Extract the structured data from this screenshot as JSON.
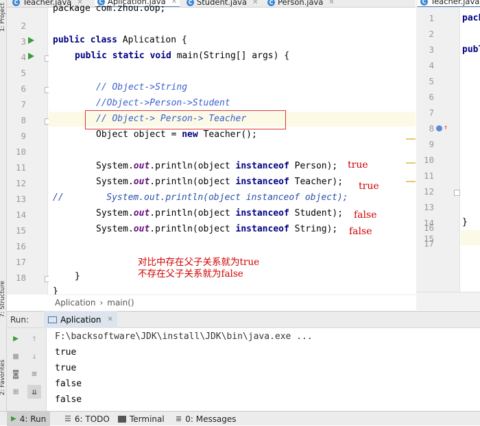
{
  "tabs": [
    {
      "label": "Teacher.java",
      "active": false
    },
    {
      "label": "Aplication.java",
      "active": true
    },
    {
      "label": "Student.java",
      "active": false
    },
    {
      "label": "Person.java",
      "active": false
    }
  ],
  "right_tab": {
    "label": "Teacher.java"
  },
  "left_strip": {
    "project": "1: Project",
    "structure": "7: Structure",
    "favorites": "2: Favorites"
  },
  "editor": {
    "line_numbers": [
      "2",
      "3",
      "4",
      "5",
      "6",
      "7",
      "8",
      "9",
      "10",
      "11",
      "12",
      "13",
      "14",
      "15",
      "16",
      "17",
      "18"
    ],
    "lines": {
      "l1": "package com.zhou.oop;",
      "l3_kw": "public class",
      "l3_name": " Aplication {",
      "l4_kw1": "public static void",
      "l4_rest": " main(String[] args) {",
      "l6": "// Object->String",
      "l7": "//Object->Person->Student",
      "l8": "// Object-> Person-> Teacher",
      "l9_a": "Object object = ",
      "l9_kw": "new",
      "l9_b": " Teacher();",
      "sys": "System.",
      "out": "out",
      "println": ".println(",
      "obj": "object ",
      "instanceof": "instanceof",
      "l11_type": " Person);",
      "l12_type": " Teacher);",
      "l13": "//        System.out.println(object instanceof object);",
      "l14_type": " Student);",
      "l15_type": " String);",
      "l18": "}",
      "l19": "}"
    }
  },
  "annotations": {
    "a11": "true",
    "a12": "true",
    "a14": "false",
    "a15": "false",
    "note1": "对比中存在父子关系就为true",
    "note2": "不存在父子关系就为false"
  },
  "right_editor": {
    "line_numbers": [
      "1",
      "2",
      "3",
      "4",
      "5",
      "6",
      "7",
      "8",
      "9",
      "10",
      "11",
      "12",
      "13",
      "14",
      "15",
      "16",
      "17"
    ],
    "l1": "pack",
    "l3": "publ",
    "l16": "}"
  },
  "breadcrumb": {
    "item1": "Aplication",
    "sep": "›",
    "item2": "main()"
  },
  "run": {
    "title": "Run:",
    "tab_label": "Aplication",
    "output": [
      "F:\\backsoftware\\JDK\\install\\JDK\\bin\\java.exe ...",
      "true",
      "true",
      "false",
      "false"
    ]
  },
  "statusbar": {
    "run": "4: Run",
    "todo": "6: TODO",
    "terminal": "Terminal",
    "messages": "0: Messages"
  },
  "colors": {
    "keyword": "#000080",
    "comment": "#3a5fcd",
    "annotation": "#d00000",
    "run_arrow": "#3a9b3a"
  }
}
